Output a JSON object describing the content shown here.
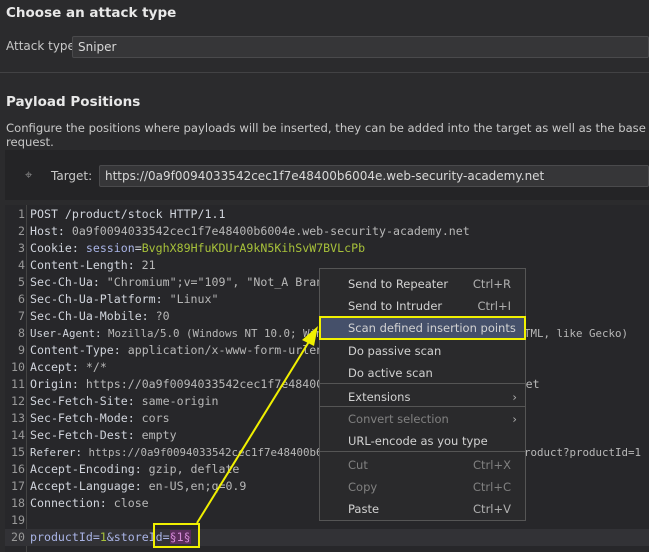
{
  "attack": {
    "heading": "Choose an attack type",
    "label": "Attack type:",
    "value": "Sniper"
  },
  "positions": {
    "heading": "Payload Positions",
    "description": "Configure the positions where payloads will be inserted, they can be added into the target as well as the base request.",
    "target_label": "Target:",
    "target_value": "https://0a9f0094033542cec1f7e48400b6004e.web-security-academy.net"
  },
  "request": [
    {
      "n": "1",
      "k": "POST /product/stock HTTP/1.1",
      "v": ""
    },
    {
      "n": "2",
      "k": "Host:",
      "v": " 0a9f0094033542cec1f7e48400b6004e.web-security-academy.net"
    },
    {
      "n": "3",
      "k": "Cookie:",
      "v": ""
    },
    {
      "n": "4",
      "k": "Content-Length:",
      "v": " 21"
    },
    {
      "n": "5",
      "k": "Sec-Ch-Ua:",
      "v": " \"Chromium\";v=\"109\", \"Not_A Brand\";v=\"99\""
    },
    {
      "n": "6",
      "k": "Sec-Ch-Ua-Platform:",
      "v": " \"Linux\""
    },
    {
      "n": "7",
      "k": "Sec-Ch-Ua-Mobile:",
      "v": " ?0"
    },
    {
      "n": "8",
      "k": "User-Agent:",
      "v": " Mozilla/5.0 (Windows NT 10.0; Win64; x64) AppleWebKit/537.36 (KHTML, like Gecko)"
    },
    {
      "n": "9",
      "k": "Content-Type:",
      "v": " application/x-www-form-urlencoded"
    },
    {
      "n": "10",
      "k": "Accept:",
      "v": " */*"
    },
    {
      "n": "11",
      "k": "Origin:",
      "v": " https://0a9f0094033542cec1f7e48400b6004e.web-security-academy.net"
    },
    {
      "n": "12",
      "k": "Sec-Fetch-Site:",
      "v": " same-origin"
    },
    {
      "n": "13",
      "k": "Sec-Fetch-Mode:",
      "v": " cors"
    },
    {
      "n": "14",
      "k": "Sec-Fetch-Dest:",
      "v": " empty"
    },
    {
      "n": "15",
      "k": "Referer:",
      "v": " https://0a9f0094033542cec1f7e48400b6004e.web-security-academy.net/product?productId=1"
    },
    {
      "n": "16",
      "k": "Accept-Encoding:",
      "v": " gzip, deflate"
    },
    {
      "n": "17",
      "k": "Accept-Language:",
      "v": " en-US,en;q=0.9"
    },
    {
      "n": "18",
      "k": "Connection:",
      "v": " close"
    },
    {
      "n": "19",
      "k": "",
      "v": ""
    },
    {
      "n": "20",
      "k": "",
      "v": ""
    }
  ],
  "cookie": {
    "name": " session",
    "eq": "=",
    "value": "BvghX89HfuKDUrA9kN5KihSvW7BVLcPb"
  },
  "body": {
    "p1": "productId=",
    "v1": "1",
    "p2": "&storeId=",
    "marker": "§1§"
  },
  "menu": [
    {
      "label": "Send to Repeater",
      "shortcut": "Ctrl+R"
    },
    {
      "label": "Send to Intruder",
      "shortcut": "Ctrl+I"
    },
    {
      "label": "Scan defined insertion points",
      "shortcut": ""
    },
    {
      "label": "Do passive scan",
      "shortcut": ""
    },
    {
      "label": "Do active scan",
      "shortcut": ""
    },
    {
      "label": "Extensions",
      "shortcut": ""
    },
    {
      "label": "Convert selection",
      "shortcut": ""
    },
    {
      "label": "URL-encode as you type",
      "shortcut": ""
    },
    {
      "label": "Cut",
      "shortcut": "Ctrl+X"
    },
    {
      "label": "Copy",
      "shortcut": "Ctrl+C"
    },
    {
      "label": "Paste",
      "shortcut": "Ctrl+V"
    }
  ],
  "annotation_color": "#f0f000"
}
